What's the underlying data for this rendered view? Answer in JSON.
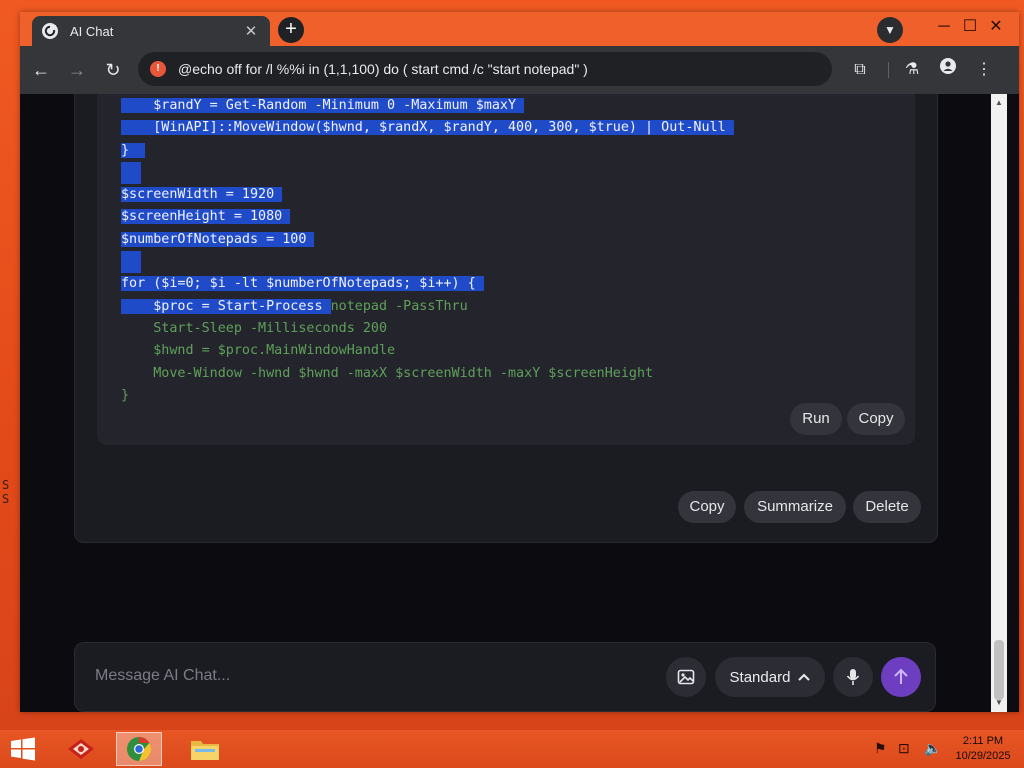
{
  "window": {
    "tab_title": "AI Chat",
    "tab_close": "✕",
    "new_tab": "+",
    "controls": {
      "minimize": "─",
      "maximize": "☐",
      "close": "✕"
    }
  },
  "toolbar": {
    "back": "←",
    "forward": "→",
    "reload": "↻",
    "url": "@echo off for /l %%i in (1,1,100) do ( start cmd /c \"start notepad\" )"
  },
  "code": {
    "lines": [
      {
        "sel": "    $randY = Get-Random -Minimum 0 -Maximum $maxY ",
        "rest": ""
      },
      {
        "sel": "    [WinAPI]::MoveWindow($hwnd, $randX, $randY, 400, 300, $true) | Out-Null ",
        "rest": ""
      },
      {
        "sel": "}  ",
        "rest": ""
      },
      {
        "sel": "",
        "rest": "",
        "empty": true
      },
      {
        "sel": "$screenWidth = 1920 ",
        "rest": ""
      },
      {
        "sel": "$screenHeight = 1080 ",
        "rest": ""
      },
      {
        "sel": "$numberOfNotepads = 100 ",
        "rest": ""
      },
      {
        "sel": "",
        "rest": "",
        "empty": true
      },
      {
        "sel": "for ($i=0; $i -lt $numberOfNotepads; $i++) { ",
        "rest": ""
      },
      {
        "sel": "    $proc = Start-Process ",
        "rest": "notepad -PassThru"
      },
      {
        "sel": "",
        "rest": "    Start-Sleep -Milliseconds 200"
      },
      {
        "sel": "",
        "rest": "    $hwnd = $proc.MainWindowHandle"
      },
      {
        "sel": "",
        "rest": "    Move-Window -hwnd $hwnd -maxX $screenWidth -maxY $screenHeight"
      },
      {
        "sel": "",
        "rest": "}"
      }
    ]
  },
  "code_actions": {
    "run": "Run",
    "copy": "Copy"
  },
  "message_actions": {
    "copy": "Copy",
    "summarize": "Summarize",
    "delete": "Delete"
  },
  "composer": {
    "placeholder": "Message AI Chat...",
    "mode": "Standard"
  },
  "taskbar": {
    "time": "2:11 PM",
    "date": "10/29/2025"
  },
  "desktop_glyphs": [
    "S",
    "S"
  ]
}
